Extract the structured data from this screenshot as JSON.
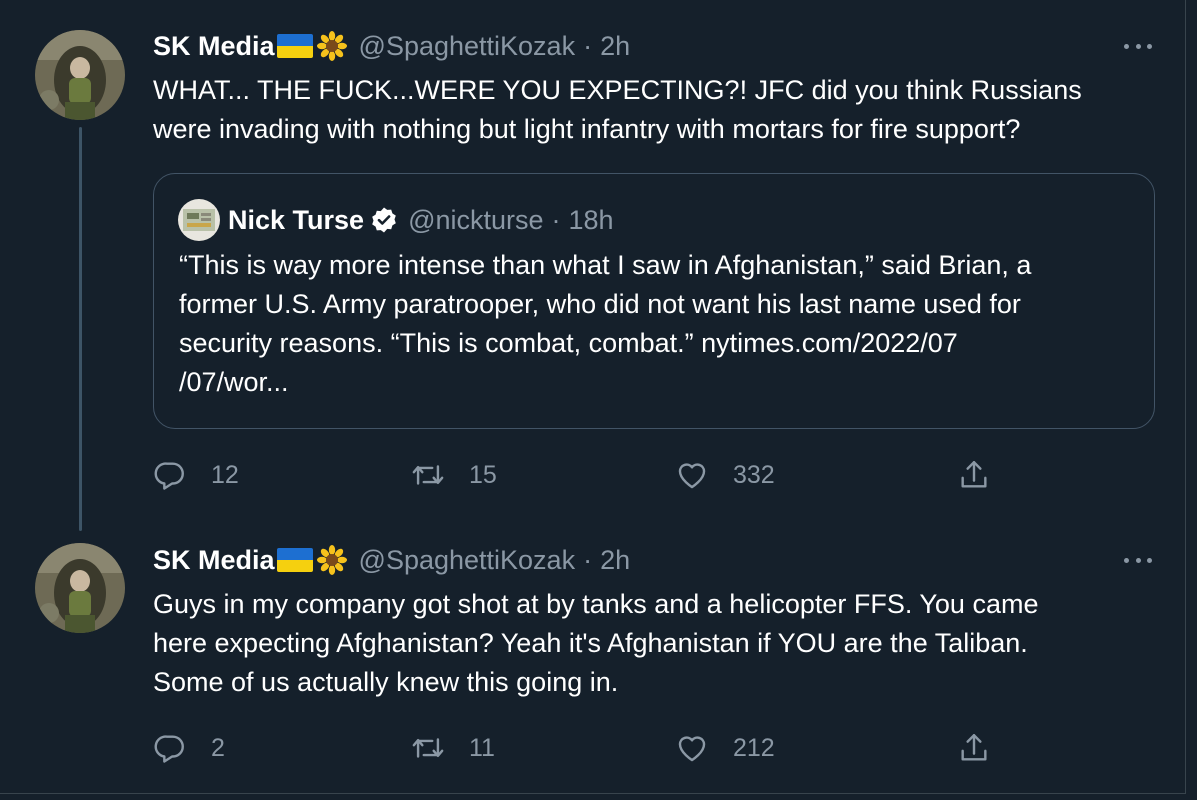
{
  "tweets": [
    {
      "author_name": "SK Media",
      "author_flag": "ukraine-flag-icon",
      "author_emoji": "sunflower-icon",
      "handle": "@SpaghettiKozak",
      "separator": "·",
      "time": "2h",
      "text_lines": [
        "WHAT... THE FUCK...WERE YOU EXPECTING?! JFC did you think Russians",
        "were invading with nothing but light infantry with mortars for fire support?"
      ],
      "quote": {
        "author_name": "Nick Turse",
        "handle": "@nickturse",
        "separator": "·",
        "time": "18h",
        "text_lines": [
          "“This is way more intense than what I saw in Afghanistan,” said Brian, a",
          "former U.S. Army paratrooper, who did not want his last name used for",
          "security reasons. “This is combat, combat.” nytimes.com/2022/07",
          "/07/wor..."
        ]
      },
      "counts": {
        "replies": "12",
        "retweets": "15",
        "likes": "332"
      }
    },
    {
      "author_name": "SK Media",
      "author_flag": "ukraine-flag-icon",
      "author_emoji": "sunflower-icon",
      "handle": "@SpaghettiKozak",
      "separator": "·",
      "time": "2h",
      "text_lines": [
        "Guys in my company got shot at by tanks and a helicopter FFS. You came",
        "here expecting Afghanistan? Yeah it's Afghanistan if YOU are the Taliban.",
        "Some of us actually knew this going in."
      ],
      "counts": {
        "replies": "2",
        "retweets": "11",
        "likes": "212"
      }
    }
  ],
  "colors": {
    "background": "#15202b",
    "primary_text": "#ffffff",
    "secondary_text": "#8b98a5",
    "border": "#425466",
    "thread_line": "#3d5466"
  }
}
